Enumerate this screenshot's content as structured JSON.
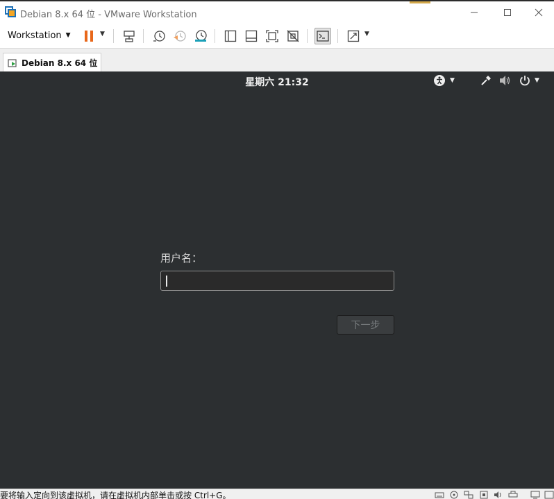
{
  "window": {
    "title": "Debian 8.x 64 位 - VMware Workstation"
  },
  "toolbar": {
    "workstation_menu": "Workstation"
  },
  "tabs": [
    {
      "label": "Debian 8.x 64 位"
    }
  ],
  "guest": {
    "clock": "星期六 21:32",
    "login": {
      "username_label": "用户名：",
      "username_value": "",
      "next_button": "下一步"
    }
  },
  "statusbar": {
    "message": "要将输入定向到该虚拟机，请在虚拟机内部单击或按 Ctrl+G。"
  },
  "colors": {
    "pause_accent": "#e8671a",
    "guest_background": "#2c2f31"
  }
}
